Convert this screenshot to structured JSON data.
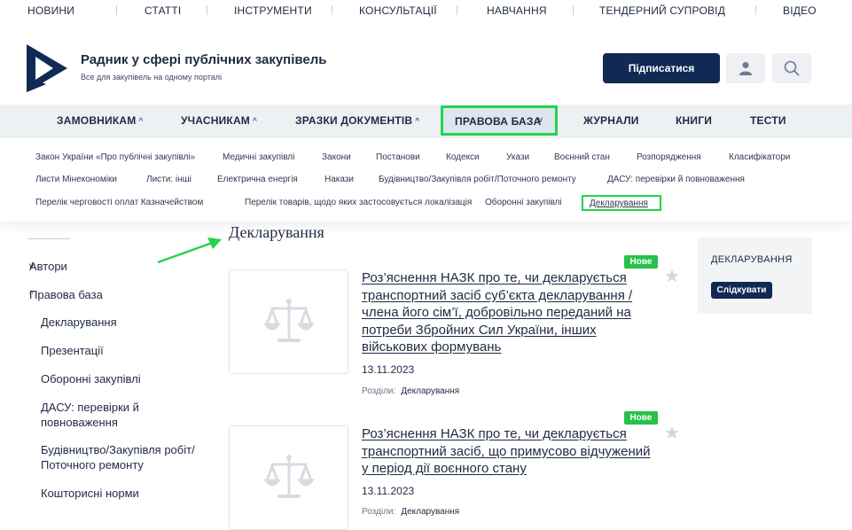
{
  "top_nav": [
    "НОВИНИ",
    "СТАТТІ",
    "ІНСТРУМЕНТИ",
    "КОНСУЛЬТАЦІЇ",
    "НАВЧАННЯ",
    "ТЕНДЕРНИЙ СУПРОВІД",
    "ВІДЕО"
  ],
  "brand": {
    "title": "Радник у сфері публічних закупівель",
    "subtitle": "Все для закупівель на одному порталі"
  },
  "header": {
    "subscribe_label": "Підписатися",
    "user_icon": "user-icon",
    "search_icon": "search-icon"
  },
  "main_nav": [
    {
      "label": "ЗАМОВНИКАМ",
      "caret": "^"
    },
    {
      "label": "УЧАСНИКАМ",
      "caret": "^"
    },
    {
      "label": "ЗРАЗКИ ДОКУМЕНТІВ",
      "caret": "^"
    },
    {
      "label": "ПРАВОВА БАЗА",
      "caret": "v"
    },
    {
      "label": "ЖУРНАЛИ",
      "caret": ""
    },
    {
      "label": "КНИГИ",
      "caret": ""
    },
    {
      "label": "ТЕСТИ",
      "caret": ""
    }
  ],
  "sub_nav": [
    "Закон України «Про публічні закупівлі»",
    "Медичні закупівлі",
    "Закони",
    "Постанови",
    "Кодекси",
    "Укази",
    "Воєнний стан",
    "Розпорядження",
    "Класифікатори",
    "Листи Мінекономіки",
    "Листи: інші",
    "Електрична енергія",
    "Накази",
    "Будівництво/Закупівля робіт/Поточного ремонту",
    "ДАСУ: перевірки й повноваження",
    "Перелік черговості оплат Казначейством",
    "Перелік товарів, щодо яких застосовується локалізація",
    "Оборонні закупівлі",
    "Декларування"
  ],
  "page_title": "Декларування",
  "sidebar": [
    {
      "label": "Автори",
      "prefix": "v"
    },
    {
      "label": "Правова база",
      "prefix": "^"
    },
    {
      "label": "Декларування",
      "prefix": ""
    },
    {
      "label": "Презентації",
      "prefix": ""
    },
    {
      "label": "Оборонні закупівлі",
      "prefix": ""
    },
    {
      "label": "ДАСУ: перевірки й повноваження",
      "prefix": ""
    },
    {
      "label": "Будівництво/Закупівля робіт/ Поточного ремонту",
      "prefix": ""
    },
    {
      "label": "Кошторисні норми",
      "prefix": ""
    }
  ],
  "articles": [
    {
      "badge": "Нове",
      "title": "Роз’яснення НАЗК про те, чи декларується транспортний засіб суб’єкта декларування / члена його сім’ї, добровільно переданий на потреби Збройних Сил України, інших військових формувань",
      "date": "13.11.2023",
      "section_label": "Розділи:",
      "section": "Декларування"
    },
    {
      "badge": "Нове",
      "title": "Роз’яснення НАЗК про те, чи декларується транспортний засіб, що примусово відчужений у період дії воєнного стану",
      "date": "13.11.2023",
      "section_label": "Розділи:",
      "section": "Декларування"
    }
  ],
  "right_box": {
    "title": "ДЕКЛАРУВАННЯ",
    "follow_label": "Слідкувати"
  },
  "colors": {
    "primary": "#102a55",
    "accent": "#22d44a",
    "badge": "#27c04a"
  }
}
